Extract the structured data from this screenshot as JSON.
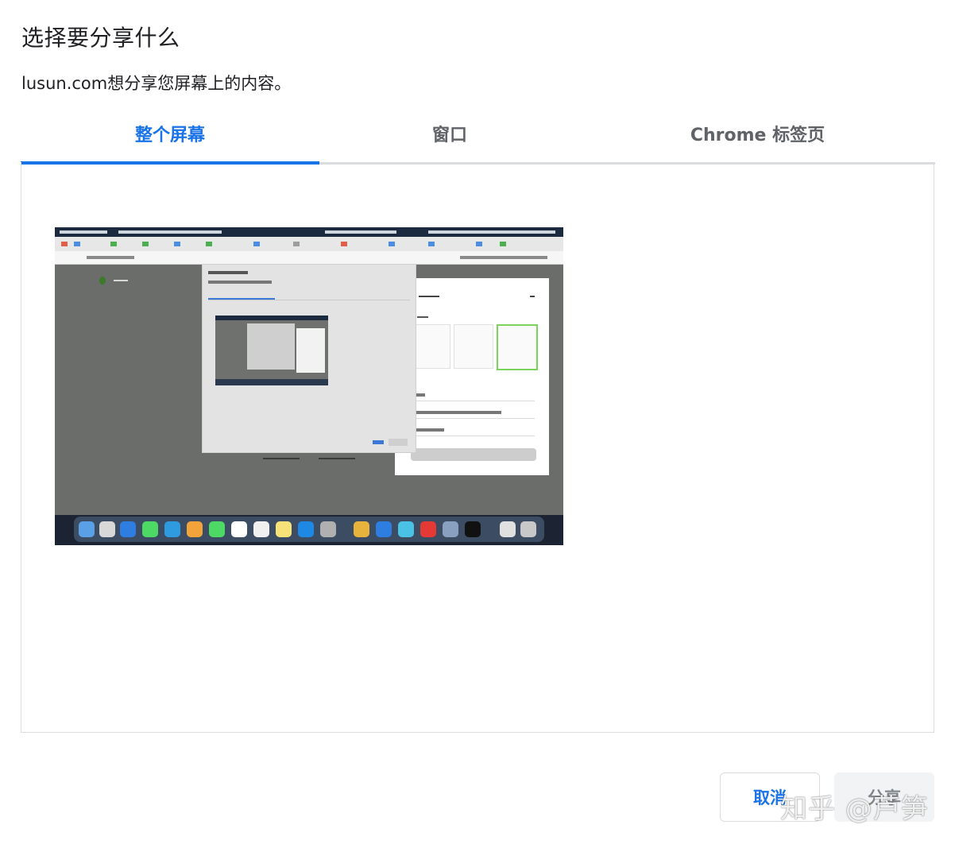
{
  "dialog": {
    "title": "选择要分享什么",
    "subtitle": "lusun.com想分享您屏幕上的内容。"
  },
  "tabs": [
    {
      "label": "整个屏幕",
      "active": true
    },
    {
      "label": "窗口",
      "active": false
    },
    {
      "label": "Chrome 标签页",
      "active": false
    }
  ],
  "screen_preview": {
    "selected": false,
    "thumbnail_icon": "desktop-screenshot"
  },
  "buttons": {
    "cancel": "取消",
    "share": "分享"
  },
  "watermark": "知乎 @芦笋",
  "colors": {
    "accent": "#1a73e8",
    "tab_inactive": "#5f6368",
    "border": "#dadce0",
    "share_disabled_bg": "#f1f3f4"
  }
}
